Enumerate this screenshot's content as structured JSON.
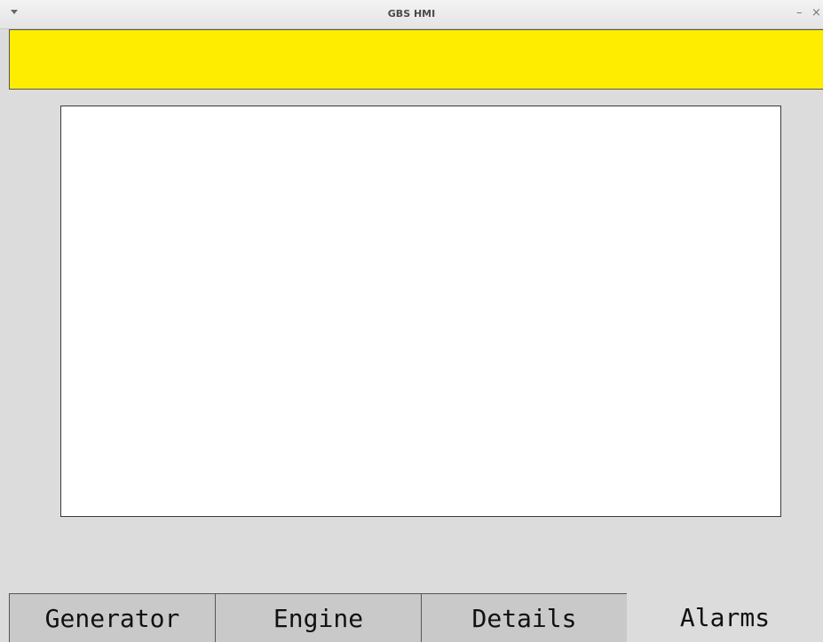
{
  "window": {
    "title": "GBS HMI",
    "minimize_glyph": "–",
    "close_glyph": "×"
  },
  "colors": {
    "banner": "#ffed00",
    "background": "#dcdcdc",
    "list_background": "#ffffff"
  },
  "tabs": [
    {
      "label": "Generator",
      "active": false
    },
    {
      "label": "Engine",
      "active": false
    },
    {
      "label": "Details",
      "active": false
    },
    {
      "label": "Alarms",
      "active": true
    }
  ]
}
